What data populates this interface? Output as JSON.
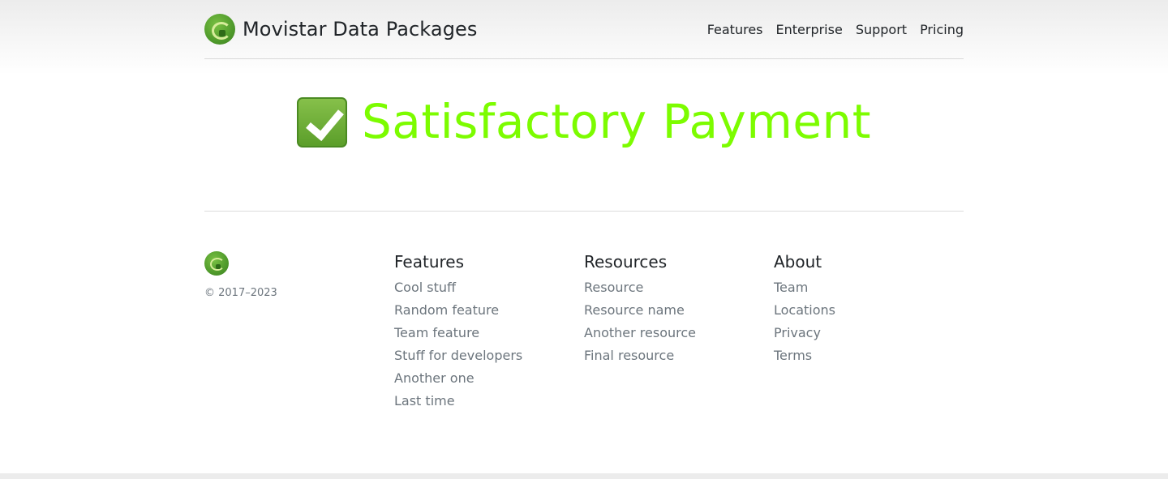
{
  "header": {
    "brand_name": "Movistar Data Packages",
    "logo_icon": "movistar-logo-icon",
    "nav": [
      {
        "label": "Features"
      },
      {
        "label": "Enterprise"
      },
      {
        "label": "Support"
      },
      {
        "label": "Pricing"
      }
    ]
  },
  "hero": {
    "icon": "check-mark-icon",
    "title": "Satisfactory Payment",
    "title_color": "#7cfc00"
  },
  "footer": {
    "copyright": "© 2017–2023",
    "columns": [
      {
        "heading": "Features",
        "links": [
          "Cool stuff",
          "Random feature",
          "Team feature",
          "Stuff for developers",
          "Another one",
          "Last time"
        ]
      },
      {
        "heading": "Resources",
        "links": [
          "Resource",
          "Resource name",
          "Another resource",
          "Final resource"
        ]
      },
      {
        "heading": "About",
        "links": [
          "Team",
          "Locations",
          "Privacy",
          "Terms"
        ]
      }
    ]
  },
  "colors": {
    "accent": "#7cfc00",
    "logo_green": "#4f9a2b",
    "muted_text": "#6c757d"
  }
}
